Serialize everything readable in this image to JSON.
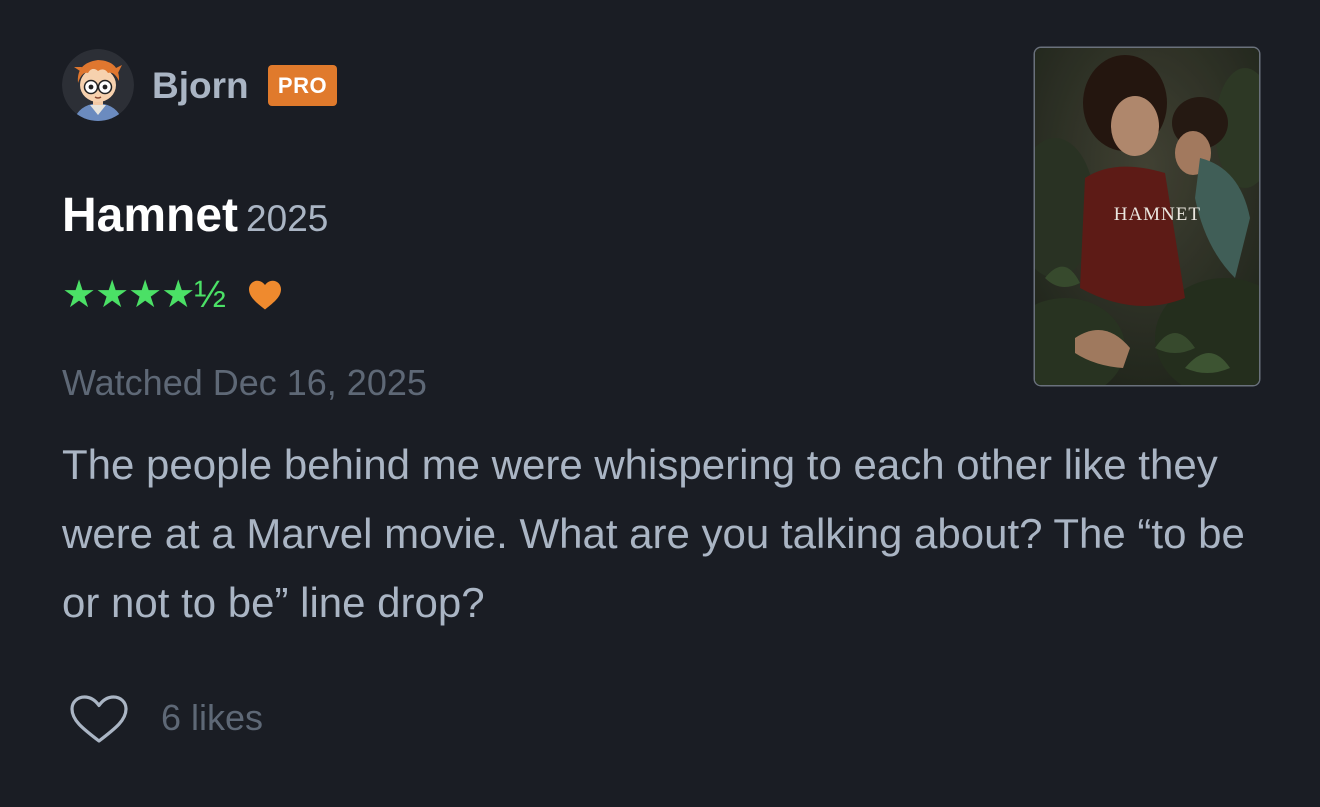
{
  "review": {
    "user": {
      "name": "Bjorn",
      "badge": "PRO"
    },
    "film": {
      "title": "Hamnet",
      "year": "2025"
    },
    "rating": {
      "stars": 4.5,
      "display": "★★★★½",
      "liked": true
    },
    "watched": "Watched Dec 16, 2025",
    "text": "The people behind me were whispering to each other like they were at a Marvel movie. What are you talking about? The “to be or not to be” line drop?",
    "likes": "6 likes",
    "poster": {
      "title": "HAMNET"
    }
  },
  "colors": {
    "background": "#1a1d24",
    "star": "#4be066",
    "heart": "#ef8a2e",
    "pro_badge": "#e07a2c",
    "text_secondary": "#aab5c4",
    "text_muted": "#5e6876"
  },
  "icons": {
    "rating_heart": "heart-filled-icon",
    "like_button": "heart-outline-icon"
  }
}
